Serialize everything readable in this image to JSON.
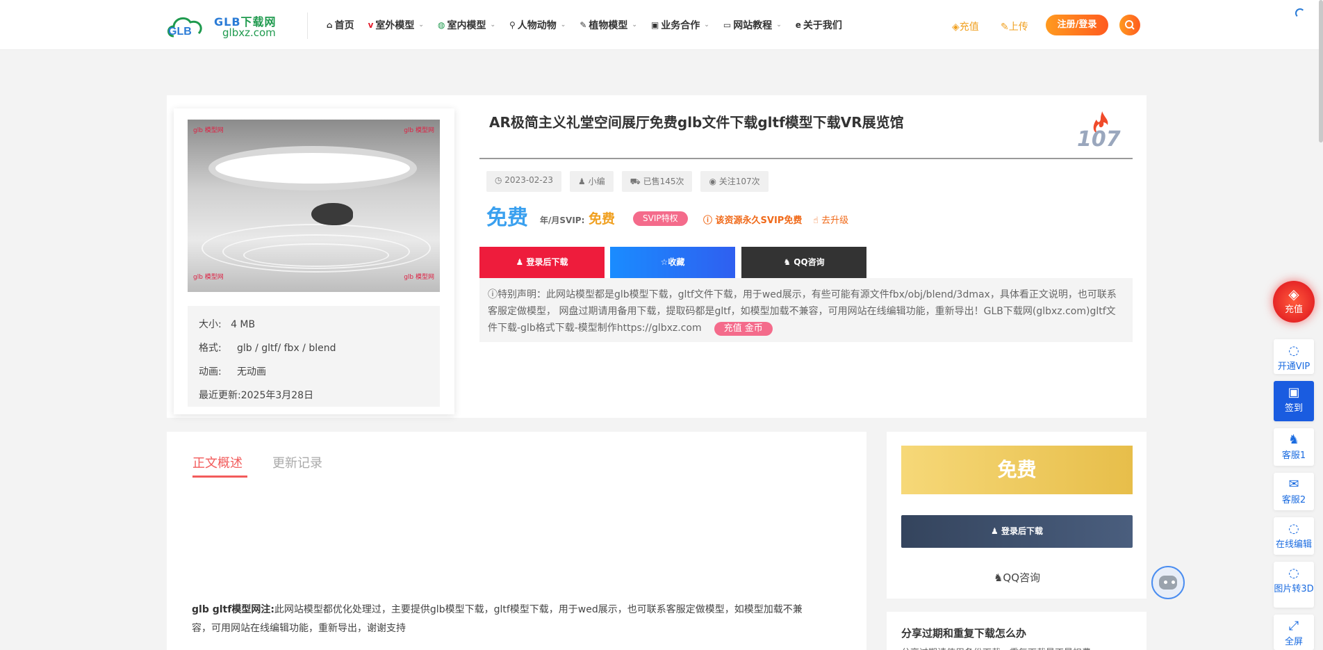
{
  "header": {
    "logo": {
      "title_a": "GLB",
      "title_b": "下载网",
      "subtitle": "glbxz.com",
      "mark": "GLB"
    },
    "nav": [
      {
        "icon": "home-icon",
        "glyph": "⌂",
        "label": "首页",
        "has_menu": false
      },
      {
        "icon": "v-icon",
        "glyph": "v",
        "label": "室外模型",
        "has_menu": true
      },
      {
        "icon": "building-icon",
        "glyph": "◍",
        "label": "室内模型",
        "has_menu": true
      },
      {
        "icon": "bicycle-icon",
        "glyph": "⚲",
        "label": "人物动物",
        "has_menu": true
      },
      {
        "icon": "leaf-icon",
        "glyph": "✎",
        "label": "植物模型",
        "has_menu": true
      },
      {
        "icon": "briefcase-icon",
        "glyph": "▣",
        "label": "业务合作",
        "has_menu": true
      },
      {
        "icon": "monitor-icon",
        "glyph": "▭",
        "label": "网站教程",
        "has_menu": true
      },
      {
        "icon": "ie-icon",
        "glyph": "e",
        "label": "关于我们",
        "has_menu": false
      }
    ],
    "recharge": "充值",
    "upload": "上传",
    "login": "注册/登录"
  },
  "product": {
    "title": "AR极简主义礼堂空间展厅免费glb文件下载gltf模型下载VR展览馆",
    "hot_count": "107",
    "meta": {
      "date": "2023-02-23",
      "author": "小编",
      "sold": "已售145次",
      "follows": "关注107次"
    },
    "price": "免费",
    "svip_label": "年/月SVIP:",
    "svip_price": "免费",
    "svip_badge": "SVIP特权",
    "permanent_note": "该资源永久SVIP免费",
    "upgrade": "去升级",
    "buttons": {
      "download": "登录后下载",
      "favorite": "收藏",
      "qq": "QQ咨询"
    },
    "notice": "特别声明：此网站模型都是glb模型下载，gltf文件下载，用于wed展示，有些可能有源文件fbx/obj/blend/3dmax，具体看正文说明，也可联系客服定做模型， 网盘过期请用备用下载，提取码都是gltf，如模型加载不兼容，可用网站在线编辑功能，重新导出！GLB下载网(glbxz.com)gltf文件下载-glb格式下载-模型制作https://glbxz.com",
    "notice_tag": "充值 金币",
    "specs": [
      {
        "label": "大小:",
        "value": "4 MB"
      },
      {
        "label": "格式:",
        "value": "glb / gltf/ fbx / blend"
      },
      {
        "label": "动画:",
        "value": "无动画"
      },
      {
        "label": "最近更新:",
        "value": "2025年3月28日"
      }
    ],
    "watermark": "glb 模型网"
  },
  "content": {
    "tabs": [
      "正文概述",
      "更新记录"
    ],
    "body_lead": "glb gltf模型网注:",
    "body_text": "此网站模型都优化处理过，主要提供glb模型下载，gltf模型下载，用于wed展示，也可联系客服定做模型，如模型加载不兼容，可用网站在线编辑功能，重新导出，谢谢支持"
  },
  "sidebar": {
    "price": "免费",
    "download": "登录后下载",
    "qq": "QQ咨询",
    "share_title": "分享过期和重复下载怎么办",
    "share_text": "分享过期请使用备份下载，重复下载是不是扣费"
  },
  "floating": [
    {
      "icon": "diamond-icon",
      "label": "充值"
    },
    {
      "icon": "bulb-icon",
      "label": "开通VIP"
    },
    {
      "icon": "calendar-check-icon",
      "label": "签到"
    },
    {
      "icon": "qq-icon",
      "label": "客服1"
    },
    {
      "icon": "wechat-icon",
      "label": "客服2"
    },
    {
      "icon": "bulb-icon",
      "label": "在线编辑"
    },
    {
      "icon": "bulb-icon",
      "label": "图片转3D"
    },
    {
      "icon": "fullscreen-icon",
      "label": "全屏"
    }
  ],
  "colors": {
    "accent_orange": "#ff6a1f",
    "price_blue": "#3aa0ef",
    "svip_pink": "#f46b8b",
    "download_red": "#ee1c3c",
    "tab_red": "#f25b5b"
  }
}
